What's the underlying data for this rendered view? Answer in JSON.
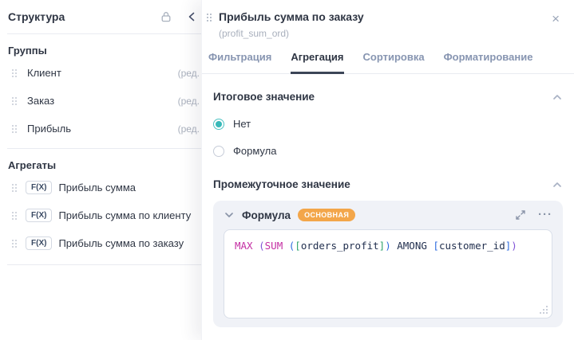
{
  "left_panel": {
    "title": "Структура",
    "groups_header": "Группы",
    "groups": [
      {
        "label": "Клиент",
        "edit": "(ред."
      },
      {
        "label": "Заказ",
        "edit": "(ред."
      },
      {
        "label": "Прибыль",
        "edit": "(ред."
      }
    ],
    "aggregates_header": "Агрегаты",
    "aggregates": [
      {
        "badge": "F(X)",
        "label": "Прибыль сумма"
      },
      {
        "badge": "F(X)",
        "label": "Прибыль сумма по клиенту"
      },
      {
        "badge": "F(X)",
        "label": "Прибыль сумма по заказу"
      }
    ]
  },
  "drawer": {
    "title": "Прибыль сумма по заказу",
    "subtitle": "(profit_sum_ord)",
    "tabs": [
      {
        "label": "Фильтрация",
        "active": false
      },
      {
        "label": "Агрегация",
        "active": true
      },
      {
        "label": "Сортировка",
        "active": false
      },
      {
        "label": "Форматирование",
        "active": false
      }
    ],
    "total_section": {
      "title": "Итоговое значение",
      "options": [
        {
          "label": "Нет",
          "selected": true
        },
        {
          "label": "Формула",
          "selected": false
        }
      ]
    },
    "intermediate_section": {
      "title": "Промежуточное значение",
      "formula_card": {
        "title": "Формула",
        "badge": "ОСНОВНАЯ",
        "formula_text": "MAX (SUM ([orders_profit]) AMONG [customer_id])",
        "formula_tokens": [
          {
            "t": "MAX ",
            "c": "fn"
          },
          {
            "t": "(",
            "c": "p1"
          },
          {
            "t": "SUM ",
            "c": "fn"
          },
          {
            "t": "(",
            "c": "p2"
          },
          {
            "t": "[",
            "c": "p3"
          },
          {
            "t": "orders_profit",
            "c": "txt"
          },
          {
            "t": "]",
            "c": "p3"
          },
          {
            "t": ")",
            "c": "p2"
          },
          {
            "t": " AMONG ",
            "c": "txt"
          },
          {
            "t": "[",
            "c": "p2"
          },
          {
            "t": "customer_id",
            "c": "txt"
          },
          {
            "t": "]",
            "c": "p2"
          },
          {
            "t": ")",
            "c": "p1"
          }
        ]
      }
    }
  },
  "icons": {
    "close": "×",
    "ellipsis": "···"
  },
  "colors": {
    "accent_teal": "#38B9B9",
    "badge_orange": "#F3A64A",
    "tab_inactive": "#8795B1",
    "text_dark": "#2F3644",
    "text_gray": "#A9B0BD",
    "syntax_function": "#C42FA3",
    "syntax_paren1": "#8153D7",
    "syntax_paren2": "#2D6BDF",
    "syntax_bracket3": "#2FA36B",
    "syntax_text": "#22304F"
  }
}
